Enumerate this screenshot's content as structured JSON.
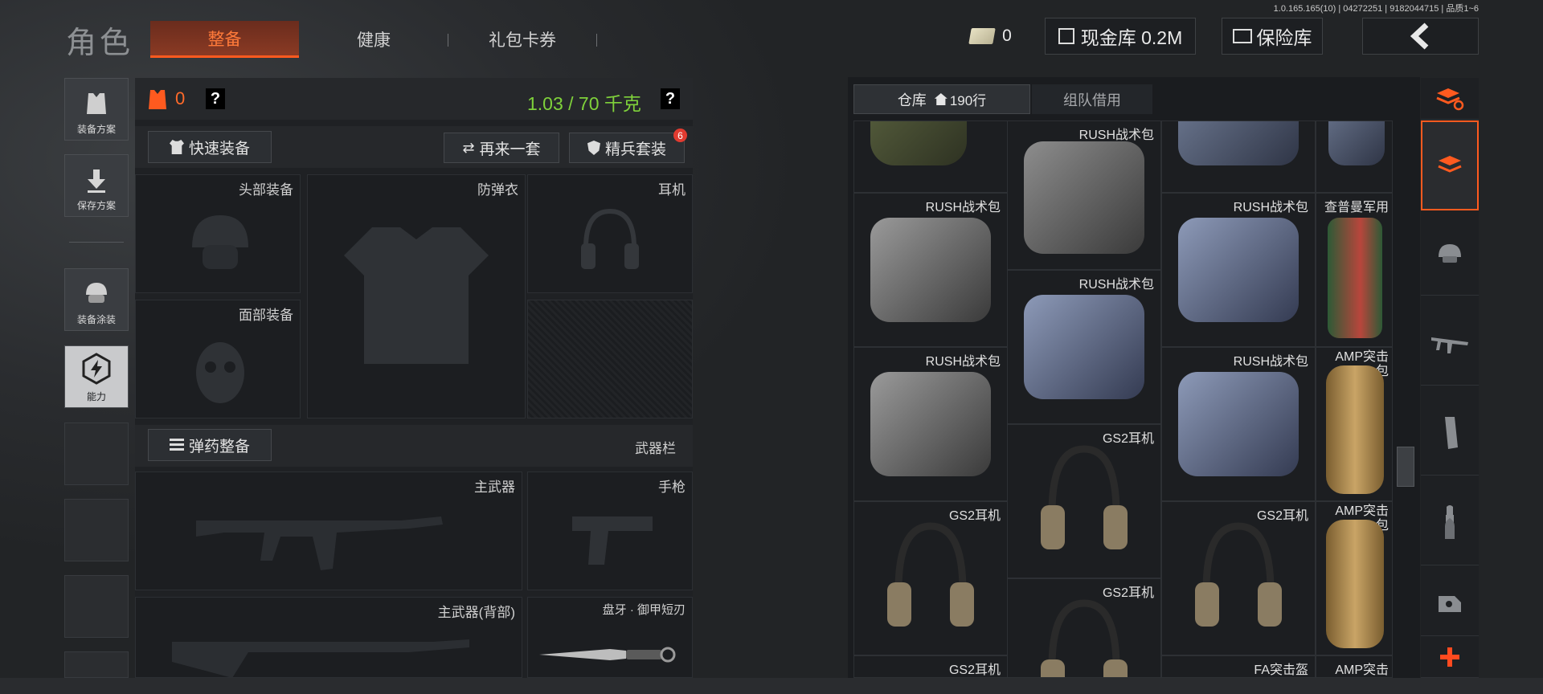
{
  "version": "1.0.165.165(10) | 04272251 | 9182044715 | 品质1~6",
  "header": {
    "title": "角色",
    "tabs": [
      {
        "label": "整备",
        "active": true
      },
      {
        "label": "健康"
      },
      {
        "label": "礼包卡券"
      }
    ],
    "money": "0",
    "cash_vault": "现金库 0.2M",
    "safe": "保险库"
  },
  "left_menu": [
    {
      "label": "装备方案",
      "icon": "vest-icon"
    },
    {
      "label": "保存方案",
      "icon": "download-icon"
    },
    {
      "label": "装备涂装",
      "icon": "helmet-icon"
    },
    {
      "label": "能力",
      "icon": "ability-icon",
      "active": true
    }
  ],
  "loadout": {
    "armor_count": "0",
    "help": "?",
    "weight": "1.03 / 70 千克",
    "quick_equip": "快速装备",
    "again": "再来一套",
    "elite": "精兵套装",
    "elite_badge": "6",
    "slots": {
      "head": "头部装备",
      "vest": "防弹衣",
      "headset": "耳机",
      "face": "面部装备"
    },
    "ammo_btn": "弹药整备",
    "weapon_bar": "武器栏",
    "primary": "主武器",
    "pistol": "手枪",
    "primary_back": "主武器(背部)",
    "melee": "盘牙 · 御甲短刃"
  },
  "storage": {
    "tab_warehouse": "仓库",
    "rows": "190行",
    "tab_team": "组队借用",
    "items": {
      "rush": "RUSH战术包",
      "rush_top": "RUSH战术包",
      "chap": "查普曼军用",
      "amp": "AMP突击包",
      "gs2": "GS2耳机",
      "fa": "FA突击盔",
      "amp_short": "AMP突击"
    }
  },
  "colors": {
    "accent": "#ff5a1f",
    "weight_green": "#7fd13b",
    "badge_red": "#e23b30"
  }
}
